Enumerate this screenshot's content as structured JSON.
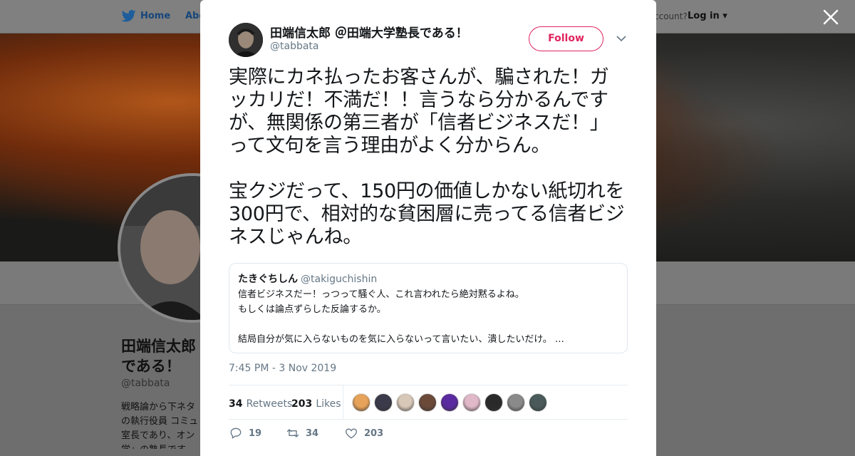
{
  "background_page": {
    "nav": {
      "home": "Home",
      "about": "Abo",
      "account": "ccount?",
      "login": "Log in"
    },
    "profile": {
      "name": "田端信太郎\nである！",
      "handle": "@tabbata",
      "bio": "戦略論から下ネタ\nの執行役員 コミュ\n室長であり、オン\n学」の塾長です"
    }
  },
  "tweet": {
    "author": {
      "name": "田端信太郎 ＠田端大学塾長である！",
      "handle": "@tabbata"
    },
    "follow_label": "Follow",
    "text": "実際にカネ払ったお客さんが、騙された！ガッカリだ！不満だ！！言うなら分かるんですが、無関係の第三者が「信者ビジネスだ！」って文句を言う理由がよく分からん。\n\n宝クジだって、150円の価値しかない紙切れを300円で、相対的な貧困層に売ってる信者ビジネスじゃんね。",
    "quote": {
      "name": "たきぐちしん",
      "handle": "@takiguchishin",
      "text": "信者ビジネスだー！っつって騒ぐ人、これ言われたら絶対黙るよね。\nもしくは論点ずらした反論するか。\n\n結局自分が気に入らないものを気に入らないって言いたい、潰したいだけ。 …"
    },
    "timestamp": "7:45 PM - 3 Nov 2019",
    "stats": {
      "retweets_count": "34",
      "retweets_label": "Retweets",
      "likes_count": "203",
      "likes_label": "Likes"
    },
    "liker_colors": [
      "#e8a35a",
      "#3a3a4a",
      "#d8c8b8",
      "#6b4a3a",
      "#5a2aa0",
      "#e0b8c8",
      "#2a2a2a",
      "#8a8a8a",
      "#4a5a5a"
    ],
    "actions": {
      "replies": "19",
      "retweets": "34",
      "likes": "203"
    }
  },
  "colors": {
    "follow_accent": "#e0245e",
    "text": "#14171a",
    "muted": "#657786"
  }
}
